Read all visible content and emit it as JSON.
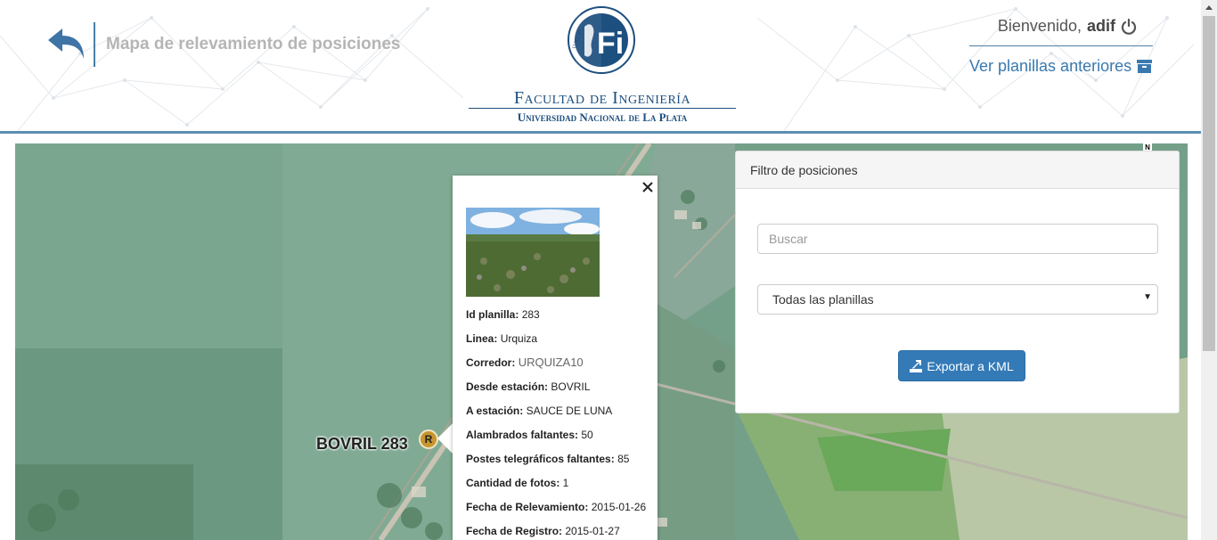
{
  "header": {
    "page_title": "Mapa de relevamiento de posiciones",
    "logo_letters": "Fi",
    "logo_ring_text": "U.N.L.P.",
    "faculty_name": "Facultad de Ingeniería",
    "university_name": "Universidad Nacional de La Plata",
    "welcome_prefix": "Bienvenido,",
    "username": "adif",
    "previous_sheets_link": "Ver planillas anteriores"
  },
  "map": {
    "north_label": "N",
    "marker_label": "BOVRIL 283",
    "marker_letter": "R"
  },
  "popup": {
    "fields": [
      {
        "label": "Id planilla:",
        "value": "283"
      },
      {
        "label": "Linea:",
        "value": "Urquiza"
      },
      {
        "label": "Corredor:",
        "value": "URQUIZA10"
      },
      {
        "label": "Desde estación:",
        "value": "BOVRIL"
      },
      {
        "label": "A estación:",
        "value": "SAUCE DE LUNA"
      },
      {
        "label": "Alambrados faltantes:",
        "value": "50"
      },
      {
        "label": "Postes telegráficos faltantes:",
        "value": "85"
      },
      {
        "label": "Cantidad de fotos:",
        "value": "1"
      },
      {
        "label": "Fecha de Relevamiento:",
        "value": "2015-01-26"
      },
      {
        "label": "Fecha de Registro:",
        "value": "2015-01-27"
      }
    ]
  },
  "filter": {
    "title": "Filtro de posiciones",
    "search_placeholder": "Buscar",
    "select_value": "Todas las planillas",
    "export_label": "Exportar a KML"
  },
  "colors": {
    "accent": "#337ab7",
    "header_border": "#5b8fb3",
    "faculty_blue": "#1d4f7f",
    "marker": "#c79530"
  },
  "icons": {
    "back": "back-arrow-icon",
    "power": "power-icon",
    "archive": "archive-icon",
    "close": "close-icon",
    "export": "export-icon"
  }
}
